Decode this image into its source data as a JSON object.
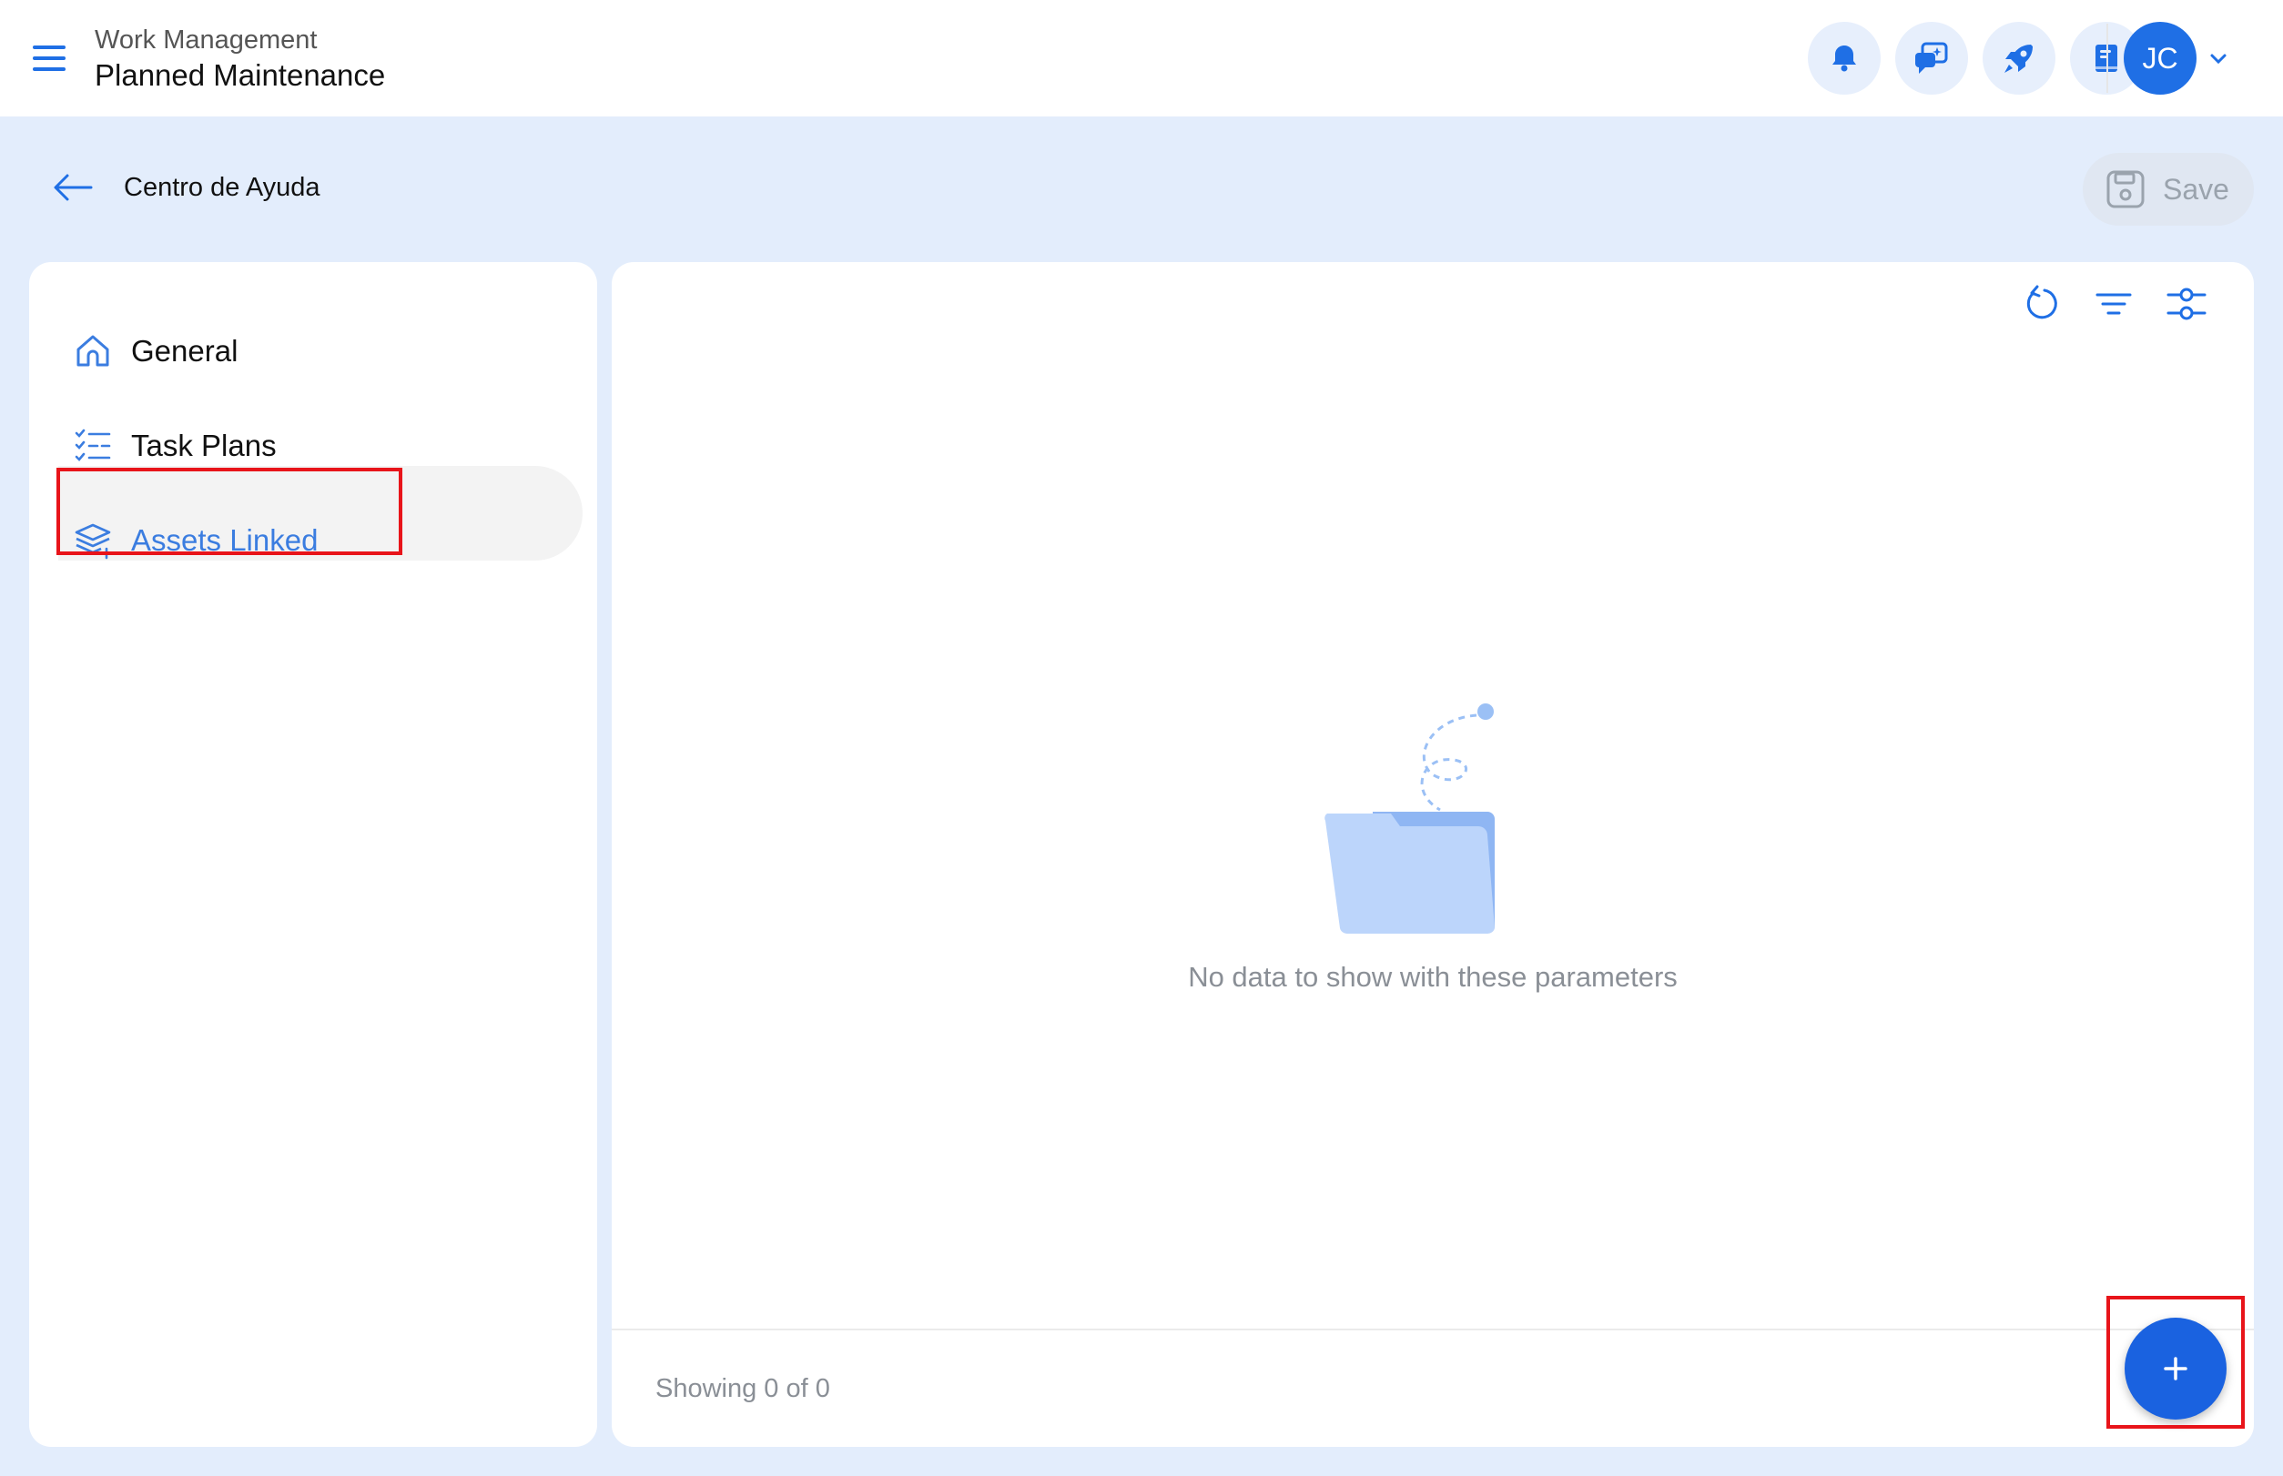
{
  "header": {
    "app_subtitle": "Work Management",
    "app_title": "Planned Maintenance",
    "icons": [
      "bell-icon",
      "chat-icon",
      "rocket-icon",
      "book-icon"
    ],
    "avatar_initials": "JC"
  },
  "subheader": {
    "breadcrumb": "Centro de Ayuda",
    "save_label": "Save"
  },
  "sidebar": {
    "items": [
      {
        "label": "General",
        "icon": "home-icon",
        "active": false
      },
      {
        "label": "Task Plans",
        "icon": "checklist-icon",
        "active": false
      },
      {
        "label": "Assets Linked",
        "icon": "layers-icon",
        "active": true
      }
    ]
  },
  "main": {
    "toolbar_icons": [
      "refresh-icon",
      "filter-icon",
      "settings-sliders-icon"
    ],
    "empty_message": "No data to show with these parameters",
    "showing_text": "Showing 0 of 0",
    "fab_label": "+"
  },
  "colors": {
    "accent": "#1a62e0",
    "background": "#e3edfc",
    "highlight": "#e8141a"
  }
}
